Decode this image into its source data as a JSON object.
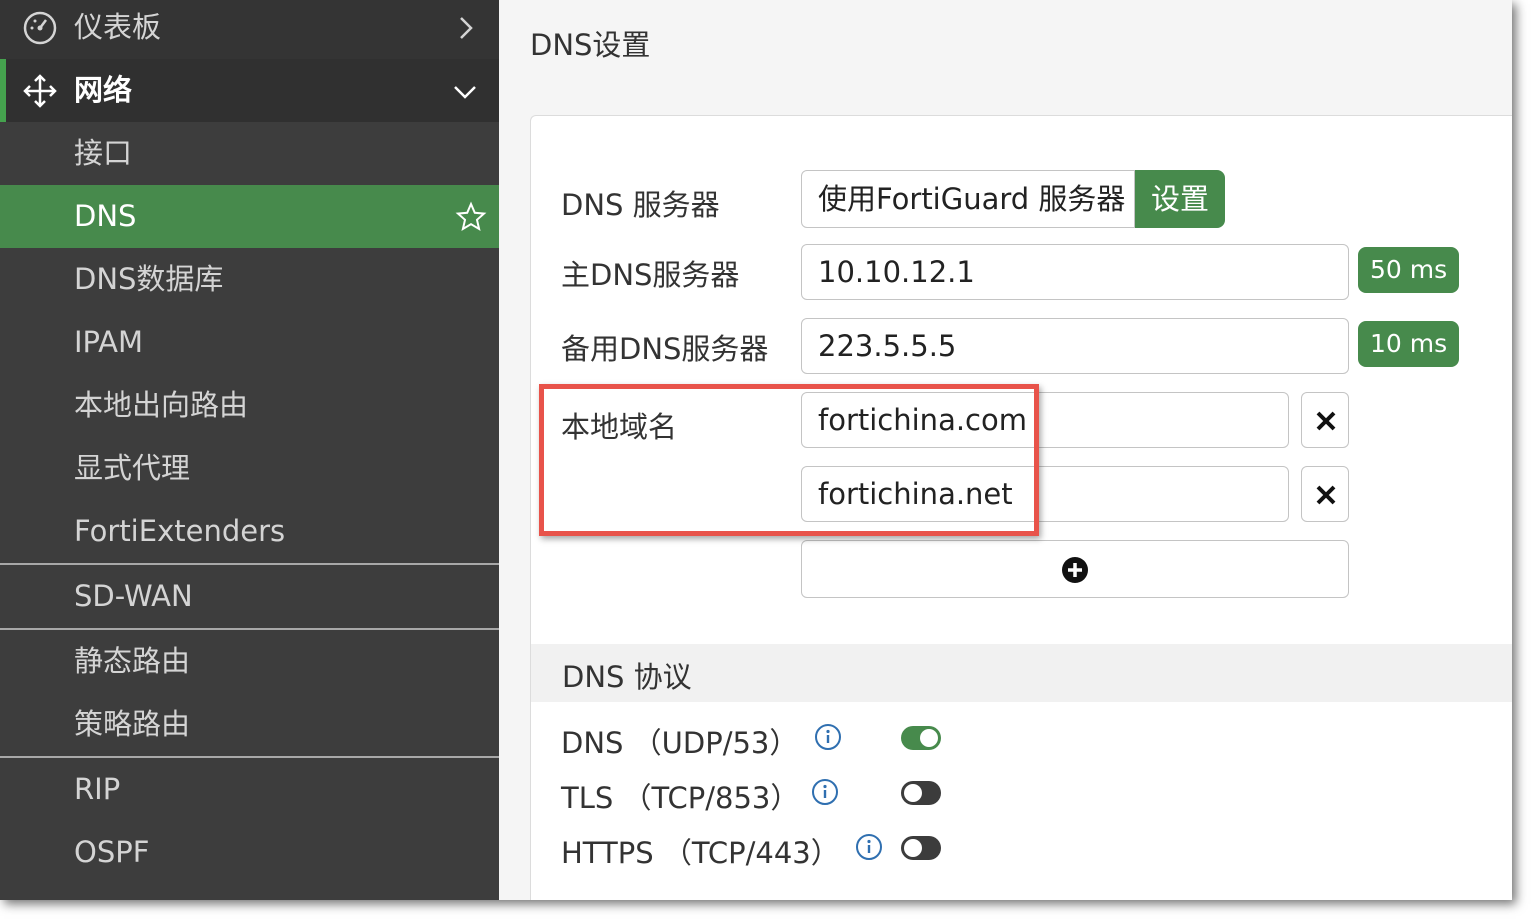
{
  "sidebar": {
    "dashboard": "仪表板",
    "network": "网络",
    "items": [
      "接口",
      "DNS",
      "DNS数据库",
      "IPAM",
      "本地出向路由",
      "显式代理",
      "FortiExtenders",
      "SD-WAN",
      "静态路由",
      "策略路由",
      "RIP",
      "OSPF"
    ],
    "active_item": "DNS"
  },
  "main": {
    "title": "DNS设置",
    "dns_servers": {
      "label": "DNS 服务器",
      "option_selected": "使用FortiGuard 服务器",
      "option_other": "设置"
    },
    "primary": {
      "label": "主DNS服务器",
      "value": "10.10.12.1",
      "latency": "50 ms"
    },
    "secondary": {
      "label": "备用DNS服务器",
      "value": "223.5.5.5",
      "latency": "10 ms"
    },
    "local_domain": {
      "label": "本地域名",
      "values": [
        "fortichina.com",
        "fortichina.net"
      ]
    },
    "protocol_section": {
      "title": "DNS 协议",
      "items": [
        {
          "label": "DNS （UDP/53）",
          "enabled": true
        },
        {
          "label": "TLS （TCP/853）",
          "enabled": false
        },
        {
          "label": "HTTPS （TCP/443）",
          "enabled": false
        }
      ]
    }
  },
  "colors": {
    "accent_green": "#478a4c",
    "sidebar_bg": "#3d3d3d",
    "highlight_red": "#e8534a"
  }
}
